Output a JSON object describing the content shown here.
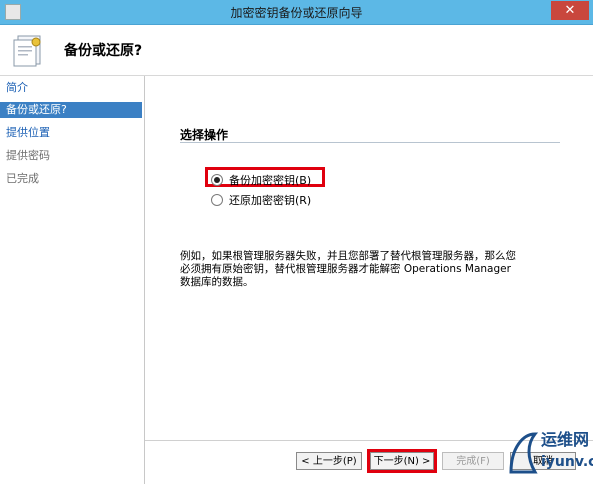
{
  "window": {
    "title": "加密密钥备份或还原向导",
    "close_glyph": "✕"
  },
  "header": {
    "title": "备份或还原?"
  },
  "nav": {
    "items": [
      {
        "label": "简介",
        "state": "link"
      },
      {
        "label": "备份或还原?",
        "state": "selected"
      },
      {
        "label": "提供位置",
        "state": "link"
      },
      {
        "label": "提供密码",
        "state": "dim"
      },
      {
        "label": "已完成",
        "state": "dim"
      }
    ]
  },
  "main": {
    "section_title": "选择操作",
    "options": [
      {
        "label": "备份加密密钥(B)",
        "selected": true
      },
      {
        "label": "还原加密密钥(R)",
        "selected": false
      }
    ],
    "description": "例如，如果根管理服务器失败，并且您部署了替代根管理服务器，那么您必须拥有原始密钥，替代根管理服务器才能解密 Operations Manager 数据库的数据。"
  },
  "footer": {
    "prev_label": "< 上一步(P)",
    "next_label": "下一步(N) >",
    "finish_label": "完成(F)",
    "cancel_label": "取消"
  },
  "watermark": {
    "line1": "运维网",
    "line2": "iyunv.com"
  },
  "colors": {
    "titlebar": "#5cb8e6",
    "nav_selected": "#3b80c4",
    "highlight": "#e0000e",
    "link": "#1a5fb4"
  }
}
